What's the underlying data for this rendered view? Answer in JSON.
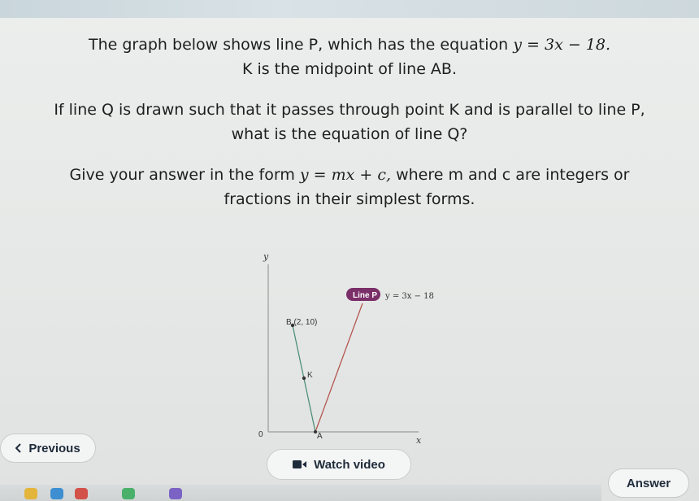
{
  "question": {
    "line1_text": "The graph below shows line P, which has the equation",
    "line1_equation": "y = 3x − 18.",
    "line2": "K is the midpoint of line AB.",
    "line3": "If line Q is drawn such that it passes through point K and is parallel to line P,",
    "line4": "what is the equation of line Q?",
    "line5_text": "Give your answer in the form",
    "line5_form": "y = mx + c,",
    "line5_rest": "where m and c are integers or",
    "line6": "fractions in their simplest forms."
  },
  "graph": {
    "y_axis_label": "y",
    "x_axis_label": "x",
    "origin_label": "0",
    "line_tag": "Line P",
    "line_equation": "y = 3x − 18",
    "point_b_label": "B (2, 10)",
    "point_k_label": "K",
    "point_a_label": "A"
  },
  "buttons": {
    "previous": "Previous",
    "watch_video": "Watch video",
    "answer": "Answer"
  },
  "colors": {
    "line_p": "#b5564f",
    "segment_ab": "#4f8f7a",
    "tag_bg": "#7b2f68"
  }
}
